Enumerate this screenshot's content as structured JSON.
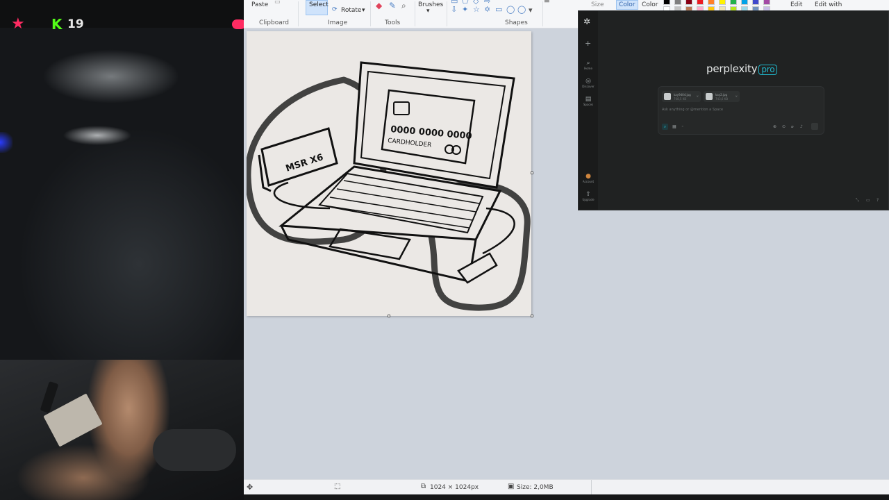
{
  "stream": {
    "viewer_count": "19",
    "kick_logo": "K",
    "icons": [
      "star-icon",
      "kick-logo-icon",
      "heart-icon"
    ]
  },
  "paint": {
    "ribbon": {
      "paste": "Paste",
      "select": "Select",
      "rotate": "Rotate",
      "brushes": "Brushes",
      "size": "Size",
      "color1": "Color",
      "color2": "Color",
      "edit": "Edit",
      "edit_with": "Edit with",
      "groups": {
        "clipboard": "Clipboard",
        "image": "Image",
        "tools": "Tools",
        "shapes": "Shapes"
      }
    },
    "canvas_art": {
      "card_number": "0000 0000 0000",
      "card_holder": "CARDHOLDER",
      "reader_label": "MSR X6"
    },
    "status": {
      "dimensions": "1024 × 1024px",
      "size": "Size: 2,0MB"
    },
    "palette": [
      "#000000",
      "#7f7f7f",
      "#880015",
      "#ed1c24",
      "#ff7f27",
      "#fff200",
      "#22b14c",
      "#00a2e8",
      "#3f48cc",
      "#a349a4",
      "#ffffff",
      "#c3c3c3",
      "#b97a57",
      "#ffaec9",
      "#ffc90e",
      "#efe4b0",
      "#b5e61d",
      "#99d9ea",
      "#7092be",
      "#c8bfe7"
    ]
  },
  "perplexity": {
    "brand": "perplexity",
    "brand_badge": "pro",
    "nav": {
      "home": "Home",
      "discover": "Discover",
      "spaces": "Spaces",
      "account": "Account",
      "upgrade": "Upgrade"
    },
    "files": [
      {
        "name": "kay9404.jpg",
        "size": "768,5 KB"
      },
      {
        "name": "kay2.jpg",
        "size": "743,6 KB"
      }
    ],
    "placeholder": "Ask anything or @mention a Space",
    "accent": "#20b8cd"
  }
}
